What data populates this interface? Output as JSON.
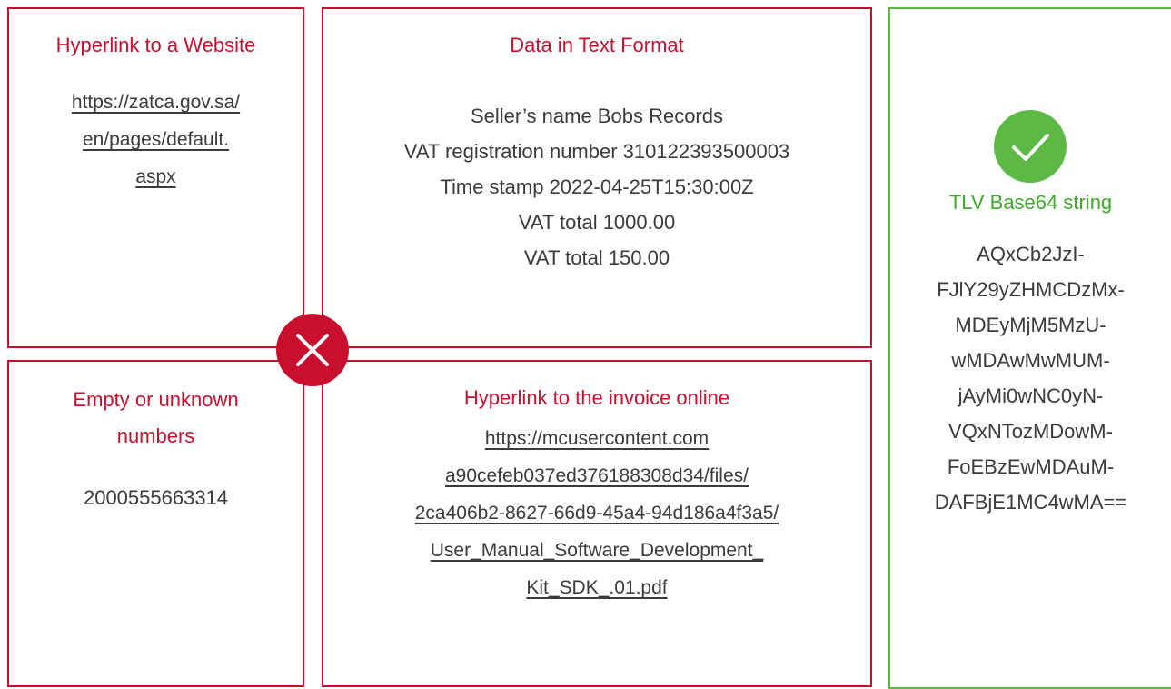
{
  "website_box": {
    "title": "Hyperlink to a Website",
    "link_lines": [
      "https://zatca.gov.sa/",
      "en/pages/default.",
      "aspx"
    ]
  },
  "text_box": {
    "title": "Data in Text Format",
    "lines": [
      "Seller’s name Bobs Records",
      "VAT registration number 310122393500003",
      "Time stamp 2022-04-25T15:30:00Z",
      "VAT total 1000.00",
      "VAT total 150.00"
    ]
  },
  "unknown_box": {
    "title_lines": [
      "Empty or unknown",
      "numbers"
    ],
    "value": "2000555663314"
  },
  "invoice_box": {
    "title": "Hyperlink to the invoice online",
    "link_lines": [
      "https://mcusercontent.com",
      "a90cefeb037ed376188308d34/files/",
      "2ca406b2-8627-66d9-45a4-94d186a4f3a5/",
      "User_Manual_Software_Development_",
      "Kit_SDK_.01.pdf"
    ]
  },
  "tlv_box": {
    "title": "TLV Base64 string",
    "lines": [
      "AQxCb2JzI-",
      "FJlY29yZHMCDzMx-",
      "MDEyMjM5MzU-",
      "wMDAwMwMUM-",
      "jAyMi0wNC0yN-",
      "VQxNTozMDowM-",
      "FoEBzEwMDAuM-",
      "DAFBjE1MC4wMA=="
    ]
  },
  "colors": {
    "invalid": "#c8102e",
    "valid": "#5cb946"
  },
  "icons": {
    "invalid": "cross-icon",
    "valid": "checkmark-icon"
  }
}
